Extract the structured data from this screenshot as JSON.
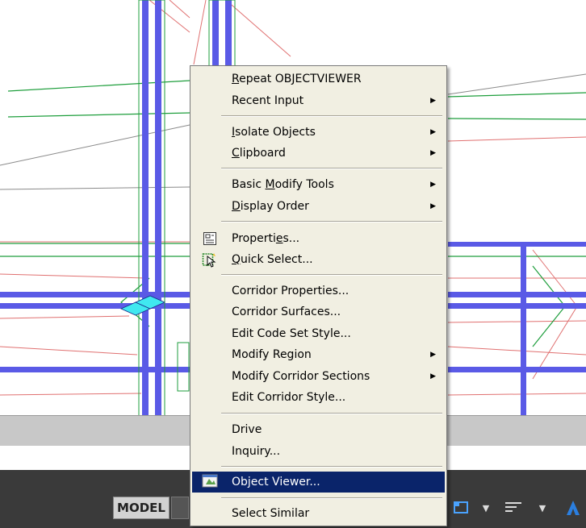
{
  "menu": {
    "items": [
      {
        "pre": "",
        "ul": "R",
        "post": "epeat OBJECTVIEWER",
        "submenu": false
      },
      {
        "pre": "Recent Input",
        "ul": "",
        "post": "",
        "submenu": true
      },
      {
        "pre": "",
        "ul": "I",
        "post": "solate Objects",
        "submenu": true
      },
      {
        "pre": "",
        "ul": "C",
        "post": "lipboard",
        "submenu": true
      },
      {
        "pre": "Basic ",
        "ul": "M",
        "post": "odify Tools",
        "submenu": true
      },
      {
        "pre": "",
        "ul": "D",
        "post": "isplay Order",
        "submenu": true
      },
      {
        "pre": "Properti",
        "ul": "e",
        "post": "s...",
        "submenu": false,
        "icon": "properties-icon"
      },
      {
        "pre": "",
        "ul": "Q",
        "post": "uick Select...",
        "submenu": false,
        "icon": "quick-select-icon"
      },
      {
        "pre": "Corridor Properties...",
        "ul": "",
        "post": "",
        "submenu": false
      },
      {
        "pre": "Corridor Surfaces...",
        "ul": "",
        "post": "",
        "submenu": false
      },
      {
        "pre": "Edit Code Set Style...",
        "ul": "",
        "post": "",
        "submenu": false
      },
      {
        "pre": "Modify Region",
        "ul": "",
        "post": "",
        "submenu": true
      },
      {
        "pre": "Modify Corridor Sections",
        "ul": "",
        "post": "",
        "submenu": true
      },
      {
        "pre": "Edit Corridor Style...",
        "ul": "",
        "post": "",
        "submenu": false
      },
      {
        "pre": "Drive",
        "ul": "",
        "post": "",
        "submenu": false
      },
      {
        "pre": "Inquiry...",
        "ul": "",
        "post": "",
        "submenu": false
      },
      {
        "pre": "Object Viewer...",
        "ul": "",
        "post": "",
        "submenu": false,
        "icon": "object-viewer-icon",
        "highlighted": true
      },
      {
        "pre": "Select Similar",
        "ul": "",
        "post": "",
        "submenu": false
      }
    ]
  },
  "status_bar": {
    "model_label": "MODEL"
  },
  "colors": {
    "menu_bg": "#f1efe2",
    "highlight": "#0a246a",
    "structure_blue": "#5a5ae6",
    "line_green": "#1e9e3c",
    "line_red": "#e06a6a",
    "cyan_marker": "#40e8f0"
  },
  "icons": [
    "properties-icon",
    "quick-select-icon",
    "object-viewer-icon",
    "grid-icon",
    "viewport-icon",
    "dropdown-caret-icon",
    "annotation-icon",
    "autodesk-a-icon",
    "submenu-arrow-icon"
  ]
}
